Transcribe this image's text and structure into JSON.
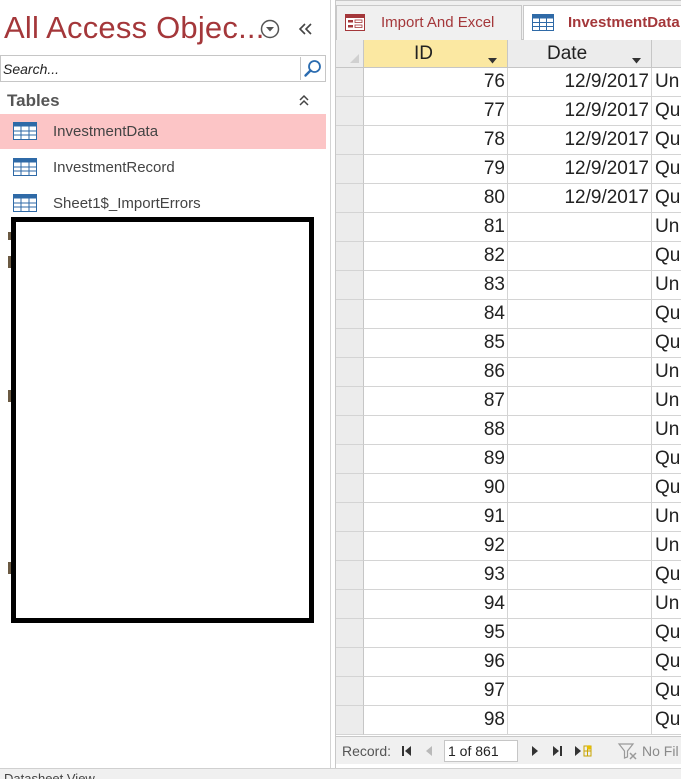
{
  "navigation_pane": {
    "title": "All Access Objec...",
    "search_placeholder": "Search...",
    "group_label": "Tables",
    "items": [
      {
        "label": "InvestmentData",
        "selected": true
      },
      {
        "label": "InvestmentRecord",
        "selected": false
      },
      {
        "label": "Sheet1$_ImportErrors",
        "selected": false
      }
    ],
    "icons": {
      "menu": "dropdown-circle-icon",
      "collapse": "double-chevron-left-icon",
      "search": "search-icon",
      "group_collapse": "double-chevron-up-icon",
      "item": "table-icon"
    }
  },
  "document_tabs": [
    {
      "label": "Import And Excel",
      "icon": "form-icon",
      "active": false
    },
    {
      "label": "InvestmentData",
      "icon": "table-icon",
      "active": true
    }
  ],
  "datasheet": {
    "columns": [
      {
        "label": "ID",
        "has_dropdown": true
      },
      {
        "label": "Date",
        "has_dropdown": true
      },
      {
        "label": "",
        "has_dropdown": false
      }
    ],
    "rows": [
      {
        "id": "76",
        "date": "12/9/2017",
        "type": "Un"
      },
      {
        "id": "77",
        "date": "12/9/2017",
        "type": "Qu"
      },
      {
        "id": "78",
        "date": "12/9/2017",
        "type": "Qu"
      },
      {
        "id": "79",
        "date": "12/9/2017",
        "type": "Qu"
      },
      {
        "id": "80",
        "date": "12/9/2017",
        "type": "Qu"
      },
      {
        "id": "81",
        "date": "",
        "type": "Un"
      },
      {
        "id": "82",
        "date": "",
        "type": "Qu"
      },
      {
        "id": "83",
        "date": "",
        "type": "Un"
      },
      {
        "id": "84",
        "date": "",
        "type": "Qu"
      },
      {
        "id": "85",
        "date": "",
        "type": "Qu"
      },
      {
        "id": "86",
        "date": "",
        "type": "Un"
      },
      {
        "id": "87",
        "date": "",
        "type": "Un"
      },
      {
        "id": "88",
        "date": "",
        "type": "Un"
      },
      {
        "id": "89",
        "date": "",
        "type": "Qu"
      },
      {
        "id": "90",
        "date": "",
        "type": "Qu"
      },
      {
        "id": "91",
        "date": "",
        "type": "Un"
      },
      {
        "id": "92",
        "date": "",
        "type": "Un"
      },
      {
        "id": "93",
        "date": "",
        "type": "Qu"
      },
      {
        "id": "94",
        "date": "",
        "type": "Un"
      },
      {
        "id": "95",
        "date": "",
        "type": "Qu"
      },
      {
        "id": "96",
        "date": "",
        "type": "Qu"
      },
      {
        "id": "97",
        "date": "",
        "type": "Qu"
      },
      {
        "id": "98",
        "date": "",
        "type": "Qu"
      }
    ]
  },
  "record_navigator": {
    "label": "Record:",
    "position": "1 of 861",
    "filter_label": "No Fil",
    "icons": [
      "first-record-icon",
      "previous-record-icon",
      "next-record-icon",
      "last-record-icon",
      "new-record-icon",
      "no-filter-icon"
    ]
  },
  "status_bar": {
    "text": "Datasheet View"
  },
  "colors": {
    "accent": "#a4373a",
    "selected_item": "#fcc5c6",
    "sorted_column_header": "#fbe8a2",
    "redaction": "#000000"
  }
}
